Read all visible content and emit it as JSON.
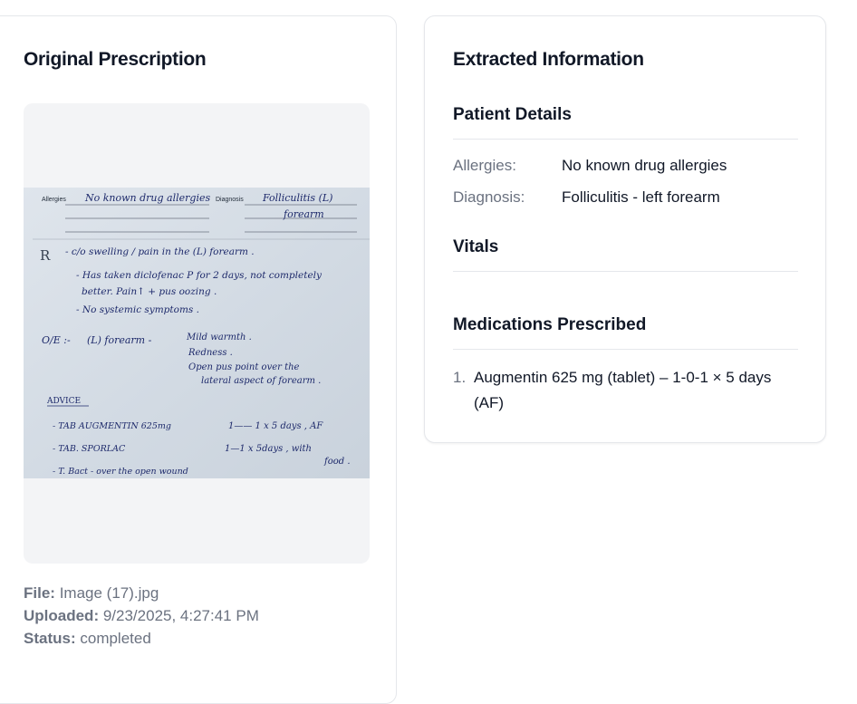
{
  "original": {
    "title": "Original Prescription",
    "file_label": "File:",
    "file_value": "Image (17).jpg",
    "uploaded_label": "Uploaded:",
    "uploaded_value": "9/23/2025, 4:27:41 PM",
    "status_label": "Status:",
    "status_value": "completed"
  },
  "extracted": {
    "title": "Extracted Information",
    "patient_details": {
      "heading": "Patient Details",
      "allergies_label": "Allergies:",
      "allergies_value": "No known drug allergies",
      "diagnosis_label": "Diagnosis:",
      "diagnosis_value": "Folliculitis - left forearm"
    },
    "vitals": {
      "heading": "Vitals"
    },
    "medications": {
      "heading": "Medications Prescribed",
      "items": [
        {
          "number": "1.",
          "line1": "Augmentin 625 mg (tablet) – 1-0-1 × 5 days",
          "line2": "(AF)"
        }
      ]
    }
  },
  "prescription_image": {
    "allergies_label": "Allergies",
    "allergies_text": "No known drug allergies",
    "diagnosis_label": "Diagnosis",
    "diagnosis_text1": "Folliculitis (L)",
    "diagnosis_text2": "forearm",
    "r_mark": "R",
    "line1": "- c/o swelling / pain in the (L) forearm .",
    "line2": "- Has taken diclofenac P for 2 days, not completely",
    "line3": "better. Pain↑ + pus oozing .",
    "line4": "- No systemic symptoms .",
    "oe": "O/E :-",
    "oe_site": "(L) forearm -",
    "oe1": "Mild warmth .",
    "oe2": "Redness .",
    "oe3": "Open pus point over the",
    "oe4": "lateral aspect of forearm .",
    "advice": "ADVICE",
    "rx1_name": "- TAB  AUGMENTIN  625mg",
    "rx1_dose": "1—— 1 x 5 days , AF",
    "rx2_name": "- TAB.  SPORLAC",
    "rx2_dose": "1—1 x 5days , with",
    "rx2_food": "food .",
    "rx3": "- T. Bact  -  over the open wound"
  }
}
